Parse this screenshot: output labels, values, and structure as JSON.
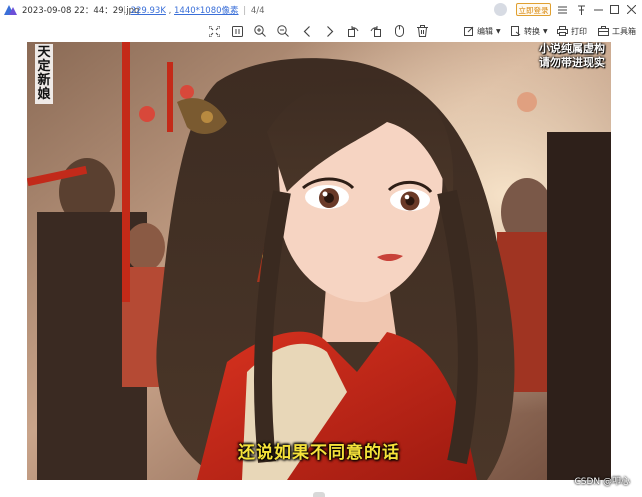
{
  "titlebar": {
    "filename": "2023-09-08 22：44：29.jpg",
    "file_size": "229.93K",
    "dimensions": "1440*1080像素",
    "page_index": "4/4",
    "login_label": "立即登录"
  },
  "toolbar": {
    "edit_label": "编辑",
    "convert_label": "转换",
    "print_label": "打印",
    "toolbox_label": "工具箱"
  },
  "image": {
    "vertical_title": "天定新娘",
    "notice_line1": "小说纯属虚构",
    "notice_line2": "请勿带进现实",
    "subtitle": "还说如果不同意的话",
    "watermark": "CSDN @叩心"
  },
  "colors": {
    "accent": "#3a6fd8",
    "login_border": "#e0a030",
    "subtitle": "#f5e23a"
  }
}
